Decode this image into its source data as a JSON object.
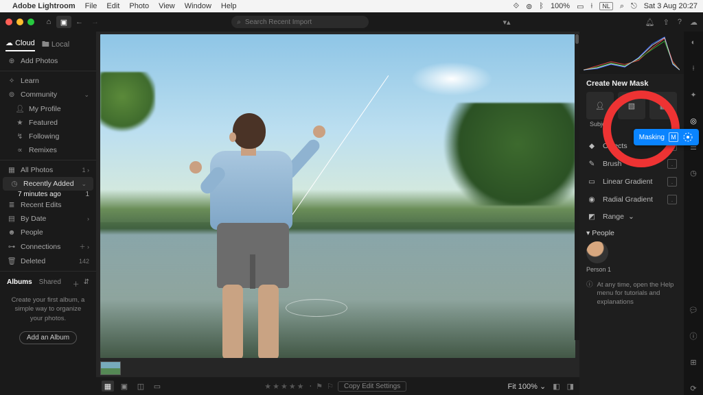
{
  "menubar": {
    "app": "Adobe Lightroom",
    "items": [
      "File",
      "Edit",
      "Photo",
      "View",
      "Window",
      "Help"
    ],
    "battery": "100%",
    "lang": "NL",
    "clock": "Sat 3 Aug  20:27"
  },
  "appbar": {
    "search_placeholder": "Search Recent Import"
  },
  "sidebar": {
    "tabs": {
      "cloud": "Cloud",
      "local": "Local"
    },
    "add_photos": "Add Photos",
    "learn": "Learn",
    "community": "Community",
    "my_profile": "My Profile",
    "featured": "Featured",
    "following": "Following",
    "remixes": "Remixes",
    "all_photos": "All Photos",
    "all_photos_count": "1",
    "recently_added": "Recently Added",
    "recent_sub": "7 minutes ago",
    "recent_sub_count": "1",
    "recent_edits": "Recent Edits",
    "by_date": "By Date",
    "people": "People",
    "connections": "Connections",
    "deleted": "Deleted",
    "deleted_count": "142",
    "albums_tab1": "Albums",
    "albums_tab2": "Shared",
    "album_hint": "Create your first album, a simple way to organize your photos.",
    "add_album": "Add an Album"
  },
  "rightpanel": {
    "title": "Create New Mask",
    "tile1": "Subject",
    "tooltip_label": "Masking",
    "tooltip_key": "M",
    "objects": "Objects",
    "brush": "Brush",
    "linear": "Linear Gradient",
    "radial": "Radial Gradient",
    "range": "Range",
    "people": "People",
    "person1": "Person 1",
    "help": "At any time, open the Help menu for tutorials and explanations"
  },
  "bottombar": {
    "copy": "Copy Edit Settings",
    "fit_label": "Fit",
    "fit_value": "100%"
  }
}
